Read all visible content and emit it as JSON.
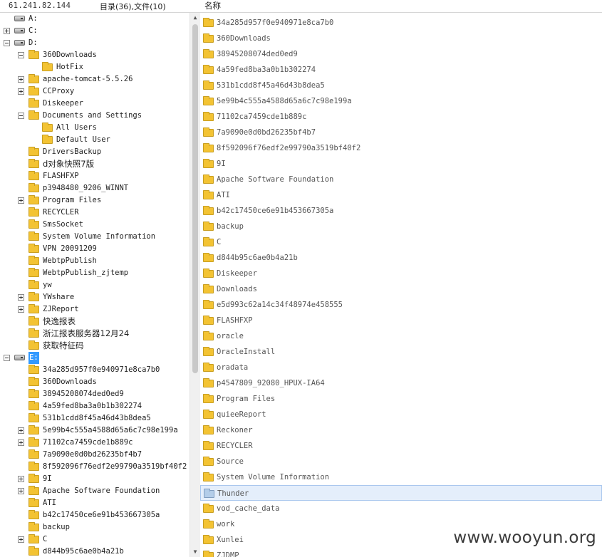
{
  "header": {
    "ip": "61.241.82.144",
    "stats": "目录(36),文件(10)",
    "name_column": "名称"
  },
  "tree": [
    {
      "label": "A:",
      "kind": "drive",
      "depth": 0,
      "expander": "none"
    },
    {
      "label": "C:",
      "kind": "drive",
      "depth": 0,
      "expander": "plus"
    },
    {
      "label": "D:",
      "kind": "drive",
      "depth": 0,
      "expander": "minus"
    },
    {
      "label": "360Downloads",
      "kind": "folder",
      "depth": 1,
      "expander": "minus"
    },
    {
      "label": "HotFix",
      "kind": "folder",
      "depth": 2,
      "expander": "none"
    },
    {
      "label": "apache-tomcat-5.5.26",
      "kind": "folder",
      "depth": 1,
      "expander": "plus"
    },
    {
      "label": "CCProxy",
      "kind": "folder",
      "depth": 1,
      "expander": "plus"
    },
    {
      "label": "Diskeeper",
      "kind": "folder",
      "depth": 1,
      "expander": "none"
    },
    {
      "label": "Documents and Settings",
      "kind": "folder",
      "depth": 1,
      "expander": "minus"
    },
    {
      "label": "All Users",
      "kind": "folder",
      "depth": 2,
      "expander": "none"
    },
    {
      "label": "Default User",
      "kind": "folder",
      "depth": 2,
      "expander": "none"
    },
    {
      "label": "DriversBackup",
      "kind": "folder",
      "depth": 1,
      "expander": "none"
    },
    {
      "label": "d对象快照7版",
      "kind": "folder",
      "depth": 1,
      "expander": "none",
      "cjk": true
    },
    {
      "label": "FLASHFXP",
      "kind": "folder",
      "depth": 1,
      "expander": "none"
    },
    {
      "label": "p3948480_9206_WINNT",
      "kind": "folder",
      "depth": 1,
      "expander": "none"
    },
    {
      "label": "Program Files",
      "kind": "folder",
      "depth": 1,
      "expander": "plus"
    },
    {
      "label": "RECYCLER",
      "kind": "folder",
      "depth": 1,
      "expander": "none"
    },
    {
      "label": "SmsSocket",
      "kind": "folder",
      "depth": 1,
      "expander": "none"
    },
    {
      "label": "System Volume Information",
      "kind": "folder",
      "depth": 1,
      "expander": "none"
    },
    {
      "label": "VPN 20091209",
      "kind": "folder",
      "depth": 1,
      "expander": "none"
    },
    {
      "label": "WebtpPublish",
      "kind": "folder",
      "depth": 1,
      "expander": "none"
    },
    {
      "label": "WebtpPublish_zjtemp",
      "kind": "folder",
      "depth": 1,
      "expander": "none"
    },
    {
      "label": "yw",
      "kind": "folder",
      "depth": 1,
      "expander": "none"
    },
    {
      "label": "YWshare",
      "kind": "folder",
      "depth": 1,
      "expander": "plus"
    },
    {
      "label": "ZJReport",
      "kind": "folder",
      "depth": 1,
      "expander": "plus"
    },
    {
      "label": "快逸报表",
      "kind": "folder",
      "depth": 1,
      "expander": "none",
      "cjk": true
    },
    {
      "label": "浙江报表服务器12月24",
      "kind": "folder",
      "depth": 1,
      "expander": "none",
      "cjk": true
    },
    {
      "label": "获取特征码",
      "kind": "folder",
      "depth": 1,
      "expander": "none",
      "cjk": true
    },
    {
      "label": "E:",
      "kind": "drive",
      "depth": 0,
      "expander": "minus",
      "selected": true
    },
    {
      "label": "34a285d957f0e940971e8ca7b0",
      "kind": "folder",
      "depth": 1,
      "expander": "none"
    },
    {
      "label": "360Downloads",
      "kind": "folder",
      "depth": 1,
      "expander": "none"
    },
    {
      "label": "38945208074ded0ed9",
      "kind": "folder",
      "depth": 1,
      "expander": "none"
    },
    {
      "label": "4a59fed8ba3a0b1b302274",
      "kind": "folder",
      "depth": 1,
      "expander": "none"
    },
    {
      "label": "531b1cdd8f45a46d43b8dea5",
      "kind": "folder",
      "depth": 1,
      "expander": "none"
    },
    {
      "label": "5e99b4c555a4588d65a6c7c98e199a",
      "kind": "folder",
      "depth": 1,
      "expander": "plus"
    },
    {
      "label": "71102ca7459cde1b889c",
      "kind": "folder",
      "depth": 1,
      "expander": "plus"
    },
    {
      "label": "7a9090e0d0bd26235bf4b7",
      "kind": "folder",
      "depth": 1,
      "expander": "none"
    },
    {
      "label": "8f592096f76edf2e99790a3519bf40f2",
      "kind": "folder",
      "depth": 1,
      "expander": "none"
    },
    {
      "label": "9I",
      "kind": "folder",
      "depth": 1,
      "expander": "plus"
    },
    {
      "label": "Apache Software Foundation",
      "kind": "folder",
      "depth": 1,
      "expander": "plus"
    },
    {
      "label": "ATI",
      "kind": "folder",
      "depth": 1,
      "expander": "none"
    },
    {
      "label": "b42c17450ce6e91b453667305a",
      "kind": "folder",
      "depth": 1,
      "expander": "none"
    },
    {
      "label": "backup",
      "kind": "folder",
      "depth": 1,
      "expander": "none"
    },
    {
      "label": "C",
      "kind": "folder",
      "depth": 1,
      "expander": "plus"
    },
    {
      "label": "d844b95c6ae0b4a21b",
      "kind": "folder",
      "depth": 1,
      "expander": "none"
    }
  ],
  "files": [
    {
      "label": "34a285d957f0e940971e8ca7b0"
    },
    {
      "label": "360Downloads"
    },
    {
      "label": "38945208074ded0ed9"
    },
    {
      "label": "4a59fed8ba3a0b1b302274"
    },
    {
      "label": "531b1cdd8f45a46d43b8dea5"
    },
    {
      "label": "5e99b4c555a4588d65a6c7c98e199a"
    },
    {
      "label": "71102ca7459cde1b889c"
    },
    {
      "label": "7a9090e0d0bd26235bf4b7"
    },
    {
      "label": "8f592096f76edf2e99790a3519bf40f2"
    },
    {
      "label": "9I"
    },
    {
      "label": "Apache Software Foundation"
    },
    {
      "label": "ATI"
    },
    {
      "label": "b42c17450ce6e91b453667305a"
    },
    {
      "label": "backup"
    },
    {
      "label": "C"
    },
    {
      "label": "d844b95c6ae0b4a21b"
    },
    {
      "label": "Diskeeper"
    },
    {
      "label": "Downloads"
    },
    {
      "label": "e5d993c62a14c34f48974e458555"
    },
    {
      "label": "FLASHFXP"
    },
    {
      "label": "oracle"
    },
    {
      "label": "OracleInstall"
    },
    {
      "label": "oradata"
    },
    {
      "label": "p4547809_92080_HPUX-IA64"
    },
    {
      "label": "Program Files"
    },
    {
      "label": "quieeReport"
    },
    {
      "label": "Reckoner"
    },
    {
      "label": "RECYCLER"
    },
    {
      "label": "Source"
    },
    {
      "label": "System Volume Information"
    },
    {
      "label": "Thunder",
      "highlighted": true
    },
    {
      "label": "vod_cache_data"
    },
    {
      "label": "work"
    },
    {
      "label": "Xunlei"
    },
    {
      "label": "ZJDMP"
    }
  ],
  "watermark": "www.wooyun.org",
  "icons": {
    "drive": "hard-drive-icon",
    "folder": "folder-icon",
    "scroll_up": "▲",
    "scroll_down": "▼"
  }
}
